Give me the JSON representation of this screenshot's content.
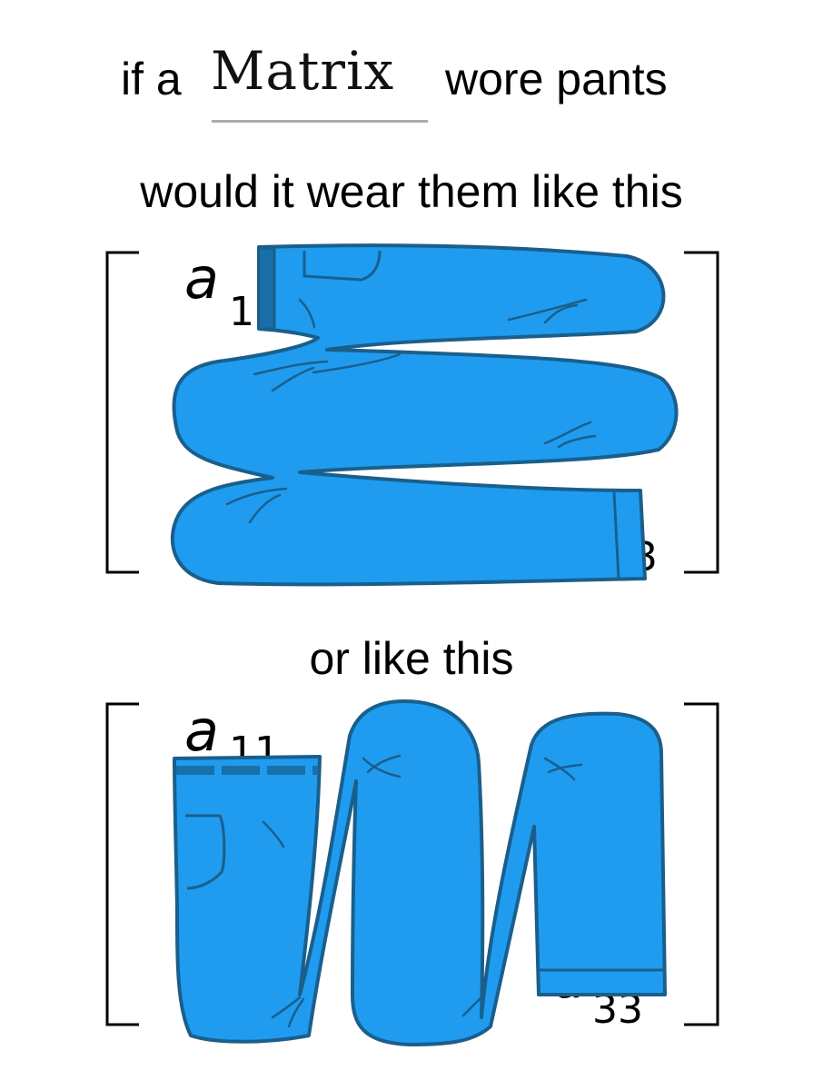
{
  "title": {
    "prefix": "if a",
    "word": "Matrix",
    "suffix": "wore pants"
  },
  "question_one": "would it wear them like this",
  "question_two": "or like this",
  "matrix_one": {
    "first_entry": {
      "letter": "a",
      "subscript": "1"
    },
    "last_entry": {
      "subscript": "3"
    }
  },
  "matrix_two": {
    "first_entry": {
      "letter": "a",
      "subscript": "11"
    },
    "last_entry": {
      "letter": "a",
      "subscript": "33"
    }
  },
  "colors": {
    "denim": "#1f9cf0",
    "outline": "#1a5f8c",
    "ink": "#000000"
  }
}
